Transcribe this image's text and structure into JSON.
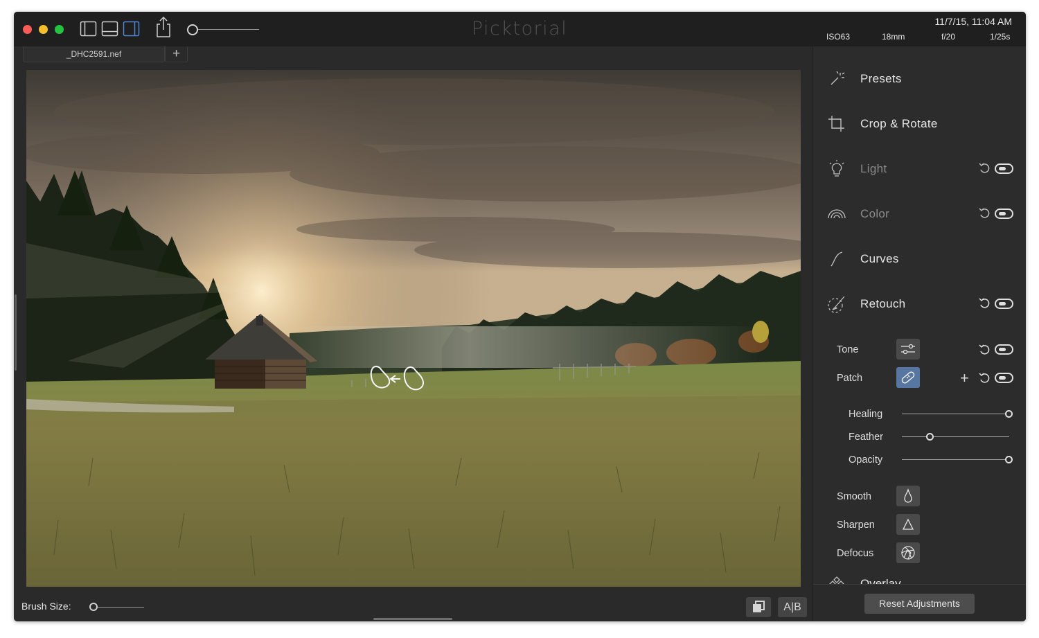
{
  "window": {
    "app_title": "Picktorial",
    "file_tab": "_DHC2591.nef",
    "add_tab": "+"
  },
  "metadata": {
    "date": "11/7/15, 11:04 AM",
    "iso": "ISO63",
    "focal_length": "18mm",
    "aperture": "f/20",
    "shutter": "1/25s"
  },
  "toolbar": {
    "zoom_level": 0.0
  },
  "bottom_bar": {
    "brush_size_label": "Brush Size:",
    "brush_size_value": 0.0,
    "compare_label": "A|B"
  },
  "panel": {
    "sections": {
      "presets": "Presets",
      "crop": "Crop & Rotate",
      "light": "Light",
      "color": "Color",
      "curves": "Curves",
      "retouch": "Retouch",
      "overlay": "Overlay"
    },
    "retouch_tools": {
      "tone": "Tone",
      "patch": "Patch",
      "smooth": "Smooth",
      "sharpen": "Sharpen",
      "defocus": "Defocus"
    },
    "patch_sliders": [
      {
        "label": "Healing",
        "value": 1.0
      },
      {
        "label": "Feather",
        "value": 0.26
      },
      {
        "label": "Opacity",
        "value": 1.0
      }
    ],
    "reset_button": "Reset Adjustments"
  },
  "colors": {
    "accent": "#5777a2",
    "window_bg": "#2a2a2a",
    "titlebar_bg": "#1f1f1f"
  }
}
